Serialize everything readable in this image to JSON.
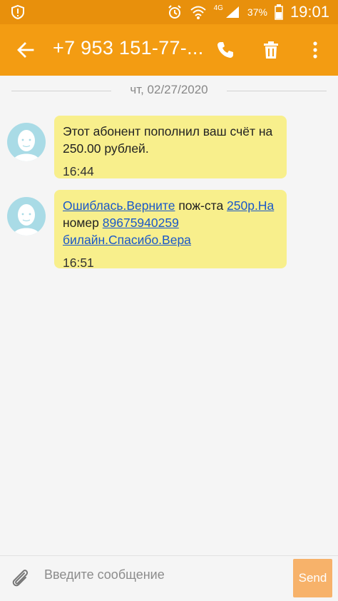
{
  "status_bar": {
    "network": "4G",
    "battery": "37%",
    "time": "19:01"
  },
  "header": {
    "title": "+7 953 151-77-..."
  },
  "conversation": {
    "date": "чт, 02/27/2020",
    "messages": [
      {
        "text": "Этот абонент пополнил ваш счёт на 250.00 рублей.",
        "time": "16:44"
      },
      {
        "parts": [
          {
            "text": "Ошиблась.Верните",
            "link": true
          },
          {
            "text": " пож-ста ",
            "link": false
          },
          {
            "text": "250р.На",
            "link": true
          },
          {
            "text": " номер ",
            "link": false
          },
          {
            "text": "89675940259",
            "link": true
          },
          {
            "text": " ",
            "link": false
          },
          {
            "text": "билайн.Спасибо.Вера",
            "link": true
          }
        ],
        "time": "16:51"
      }
    ]
  },
  "composer": {
    "placeholder": "Введите сообщение",
    "send_label": "Send"
  },
  "colors": {
    "status_bar": "#e8900c",
    "app_bar": "#f39c12",
    "bubble": "#f8ef8c",
    "send_button": "#f7b26a",
    "link": "#1a58c8"
  }
}
